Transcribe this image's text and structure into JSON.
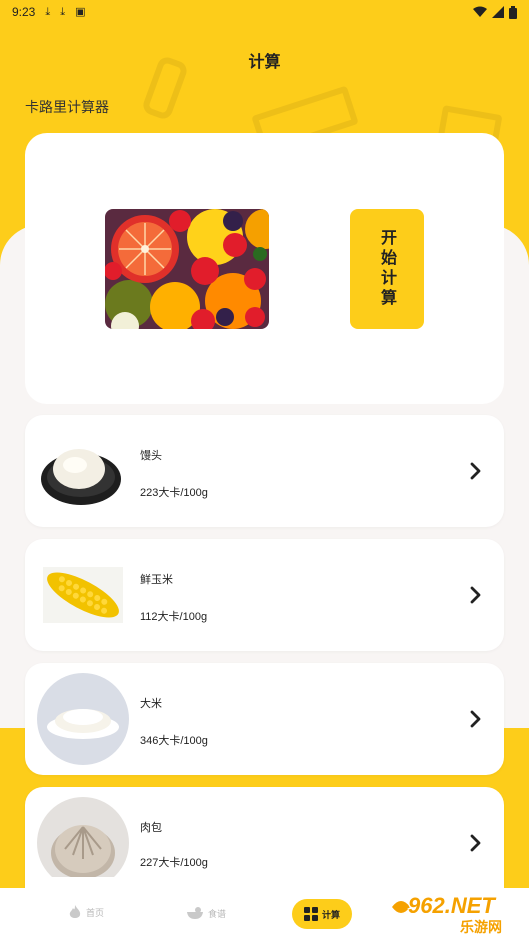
{
  "status_bar": {
    "time": "9:23",
    "left_icons": [
      "download-icon",
      "download-icon",
      "app-notification-icon"
    ],
    "right_icons": [
      "wifi-icon",
      "signal-icon",
      "battery-icon"
    ]
  },
  "header": {
    "title": "计算"
  },
  "section": {
    "title": "卡路里计算器"
  },
  "hero": {
    "image": "fruit-assortment-image",
    "start_label": "开始计算"
  },
  "foods": [
    {
      "name": "馒头",
      "calories": "223大卡/100g",
      "icon": "steamed-bun-image"
    },
    {
      "name": "鲜玉米",
      "calories": "112大卡/100g",
      "icon": "corn-image"
    },
    {
      "name": "大米",
      "calories": "346大卡/100g",
      "icon": "rice-bowl-image"
    },
    {
      "name": "肉包",
      "calories": "227大卡/100g",
      "icon": "meat-bun-image"
    }
  ],
  "tabbar": {
    "tabs": [
      {
        "label": "首页",
        "icon": "flame-icon",
        "active": false
      },
      {
        "label": "食谱",
        "icon": "bowl-icon",
        "active": false
      },
      {
        "label": "计算",
        "icon": "grid-icon",
        "active": true
      }
    ]
  },
  "watermark": {
    "brand": "962.NET",
    "sub": "乐游网"
  },
  "colors": {
    "accent": "#fdcd1a",
    "background": "#f8f5f4",
    "card": "#ffffff"
  }
}
